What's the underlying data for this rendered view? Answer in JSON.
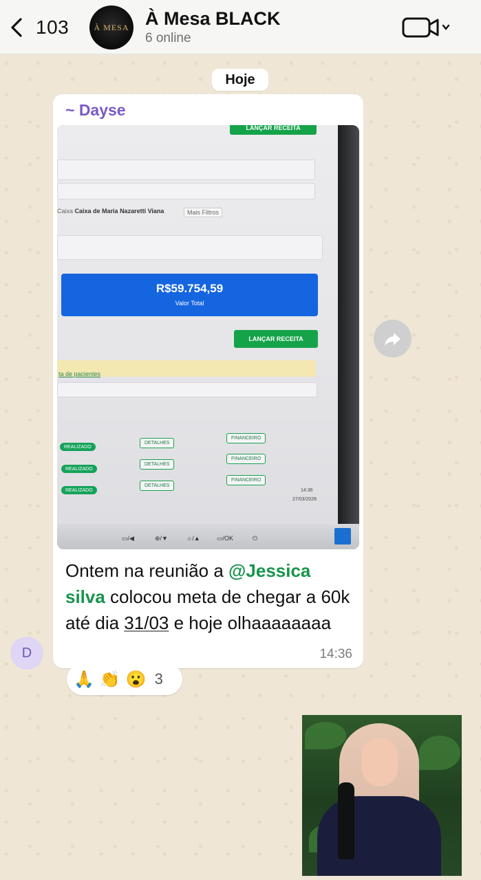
{
  "header": {
    "back_count": "103",
    "avatar_text": "À MESA",
    "title": "À Mesa BLACK",
    "subtitle": "6 online",
    "video_icon": "video-call-icon"
  },
  "chat": {
    "date_pill": "Hoje",
    "message": {
      "sender": "~ Dayse",
      "avatar_initial": "D",
      "text_before_mention": "Ontem na reunião a ",
      "mention": "@Jessica silva",
      "text_middle": " colocou meta de chegar a 60k até dia ",
      "date_link": "31/03",
      "text_after": " e hoje olhaaaaaaaa",
      "time": "14:36",
      "reactions": {
        "emojis": [
          "🙏",
          "👏",
          "😮"
        ],
        "count": "3"
      },
      "photo_content": {
        "top_button": "LANÇAR RECEITA",
        "filter_prefix": "Caixa",
        "filter_value": "Caixa de Maria Nazaretti Viana",
        "more_filters": "Mais Filtros",
        "total_value": "R$59.754,59",
        "total_label": "Valor Total",
        "action_button": "LANÇAR RECEITA",
        "list_title": "ta de pacientes",
        "rows": [
          {
            "status": "REALIZADO",
            "details": "DETALHES",
            "finance": "FINANCEIRO"
          },
          {
            "status": "REALIZADO",
            "details": "DETALHES",
            "finance": "FINANCEIRO"
          },
          {
            "status": "REALIZADO",
            "details": "DETALHES",
            "finance": "FINANCEIRO"
          }
        ],
        "taskbar_time": "14:36",
        "taskbar_date": "27/03/2026",
        "monitor_controls": [
          "▭/◀",
          "⊕/▼",
          "☼/▲",
          "▭/OK",
          "⏻"
        ]
      }
    }
  },
  "colors": {
    "sender": "#7b59c7",
    "mention": "#17944c",
    "chat_background": "#efe6d6"
  }
}
